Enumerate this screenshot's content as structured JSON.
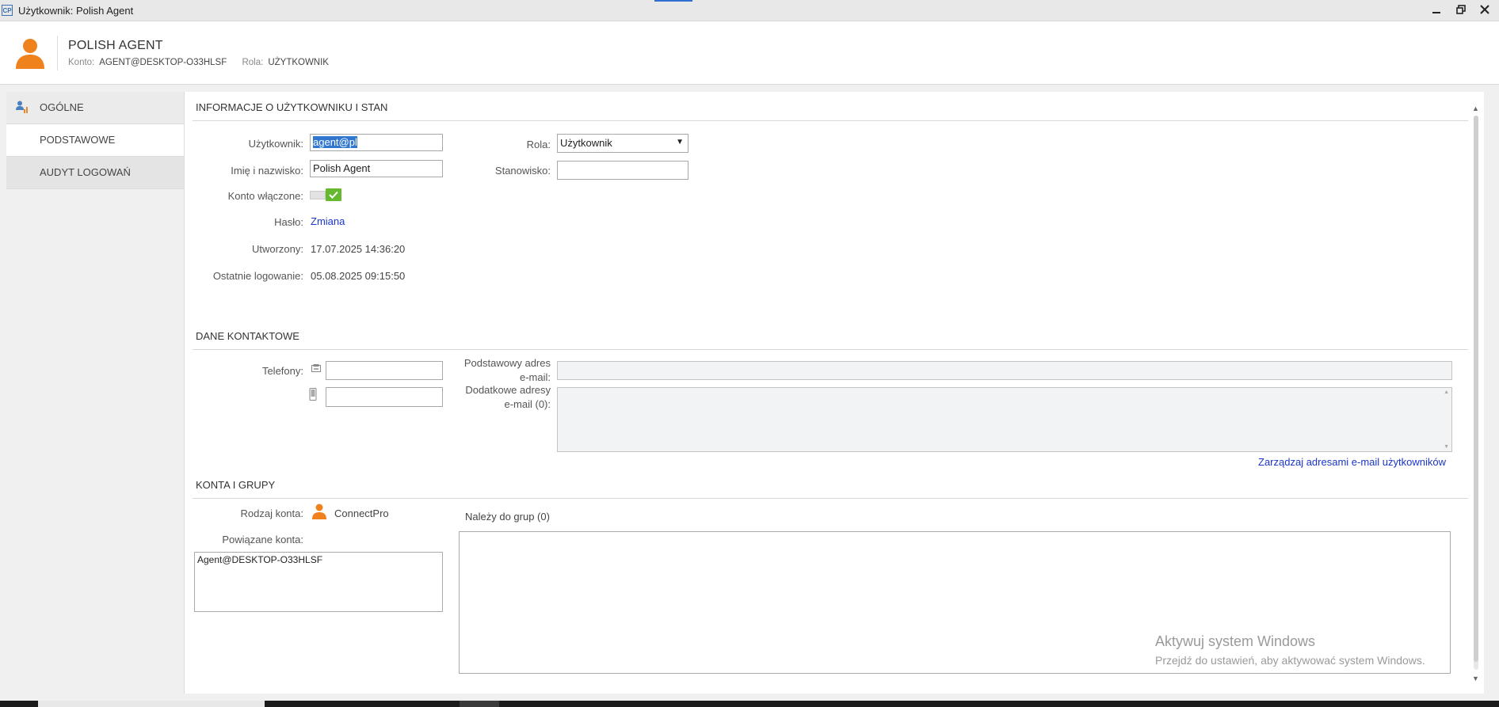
{
  "window": {
    "app_icon": "CP",
    "title": "Użytkownik: Polish Agent",
    "controls": [
      "minimize-icon",
      "restore-icon",
      "close-icon"
    ]
  },
  "header": {
    "name": "POLISH AGENT",
    "account_label": "Konto:",
    "account_value": "AGENT@DESKTOP-O33HLSF",
    "role_label": "Rola:",
    "role_value": "UŻYTKOWNIK",
    "avatar_color": "#f0821e"
  },
  "sidebar": {
    "items": [
      {
        "label": "OGÓLNE",
        "icon": "user-chart-icon"
      },
      {
        "label": "PODSTAWOWE",
        "active": true
      },
      {
        "label": "AUDYT LOGOWAŃ"
      }
    ]
  },
  "info": {
    "title": "INFORMACJE O UŻYTKOWNIKU I STAN",
    "user_label": "Użytkownik:",
    "user_value": "agent@pl",
    "fullname_label": "Imię i nazwisko:",
    "fullname_value": "Polish Agent",
    "enabled_label": "Konto włączone:",
    "enabled": true,
    "password_label": "Hasło:",
    "password_link": "Zmiana",
    "created_label": "Utworzony:",
    "created_value": "17.07.2025 14:36:20",
    "lastlogin_label": "Ostatnie logowanie:",
    "lastlogin_value": "05.08.2025 09:15:50",
    "role_label": "Rola:",
    "role_value": "Użytkownik",
    "position_label": "Stanowisko:",
    "position_value": ""
  },
  "contact": {
    "title": "DANE KONTAKTOWE",
    "phones_label": "Telefony:",
    "phone_icon": "phone-icon",
    "mobile_icon": "mobile-icon",
    "phone_value": "",
    "mobile_value": "",
    "primary_email_label_1": "Podstawowy adres",
    "primary_email_label_2": "e-mail:",
    "extra_email_label_1": "Dodatkowe adresy",
    "extra_email_label_2": "e-mail (0):",
    "manage_link": "Zarządzaj adresami e-mail użytkowników"
  },
  "accounts": {
    "title": "KONTA I GRUPY",
    "type_label": "Rodzaj konta:",
    "type_value": "ConnectPro",
    "linked_label": "Powiązane konta:",
    "linked_items": [
      "Agent@DESKTOP-O33HLSF"
    ],
    "groups_label": "Należy do grup (0)"
  },
  "watermark": {
    "line1": "Aktywuj system Windows",
    "line2": "Przejdź do ustawień, aby aktywować system Windows."
  },
  "accent": "#1a35c8",
  "toggle_on_color": "#65b92e"
}
